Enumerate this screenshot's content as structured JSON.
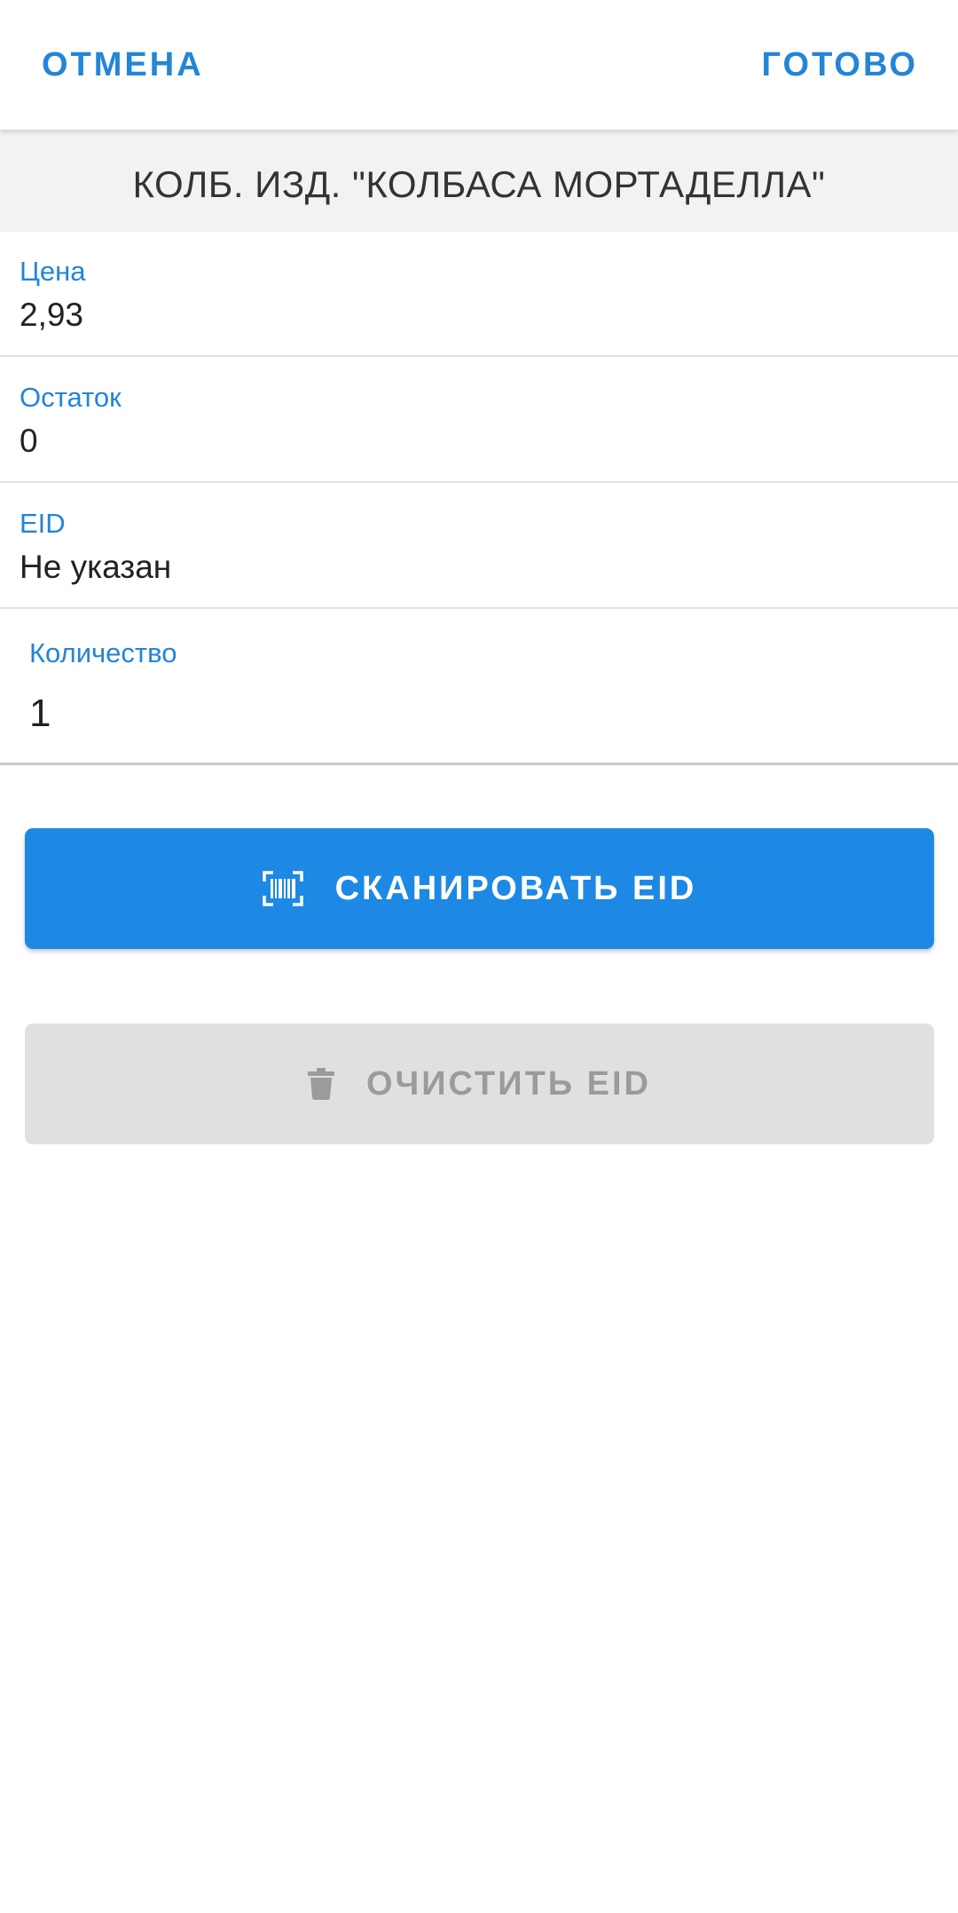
{
  "toolbar": {
    "cancel_label": "ОТМЕНА",
    "done_label": "ГОТОВО",
    "accent_color": "#2385d8"
  },
  "product": {
    "title": "КОЛБ. ИЗД. \"КОЛБАСА МОРТАДЕЛЛА\""
  },
  "fields": [
    {
      "label": "Цена",
      "value": "2,93"
    },
    {
      "label": "Остаток",
      "value": "0"
    },
    {
      "label": "EID",
      "value": "Не указан"
    }
  ],
  "quantity": {
    "label": "Количество",
    "value": "1"
  },
  "actions": {
    "scan": {
      "label": "СКАНИРОВАТЬ EID",
      "icon": "barcode-scan-icon",
      "color": "#1e88e5"
    },
    "clear": {
      "label": "ОЧИСТИТЬ EID",
      "icon": "trash-icon",
      "color": "#e0e0e0",
      "disabled": true
    }
  }
}
